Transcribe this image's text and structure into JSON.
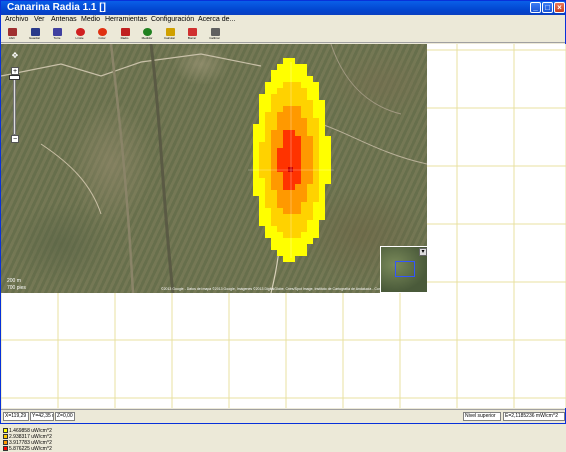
{
  "window": {
    "title": "Canarina Radia 1.1 []",
    "controls": {
      "minimize": "_",
      "maximize": "□",
      "close": "×"
    }
  },
  "menu": [
    "Archivo",
    "Ver",
    "Antenas",
    "Medio",
    "Herramientas",
    "Configuración",
    "Acerca de..."
  ],
  "toolbar": [
    {
      "label": "Abrir",
      "icon": "open-icon",
      "color": "#a03030"
    },
    {
      "label": "Guardar",
      "icon": "save-icon",
      "color": "#2a3a8a"
    },
    {
      "label": "Torre",
      "icon": "tower-icon",
      "color": "#4040a0"
    },
    {
      "label": "Limite",
      "icon": "limit-icon",
      "color": "#d02020"
    },
    {
      "label": "Color",
      "icon": "color-icon",
      "color": "#e03010"
    },
    {
      "label": "Radio",
      "icon": "radio-icon",
      "color": "#c02020"
    },
    {
      "label": "Medidor",
      "icon": "meter-icon",
      "color": "#208020"
    },
    {
      "label": "Calcular",
      "icon": "calculate-icon",
      "color": "#d0a000"
    },
    {
      "label": "Borrar",
      "icon": "erase-icon",
      "color": "#d03030"
    },
    {
      "label": "Calibrar",
      "icon": "calibrate-icon",
      "color": "#606060"
    }
  ],
  "map": {
    "scale_1": "200 m",
    "scale_2": "700 pies",
    "copyright": "©2013 Google - Datos del mapa ©2013 Google, Imágenes ©2013 DigitalGlobe, Cnes/Spot Image, Instituto de Cartografía de Andalucía - Condiciones del Servicio",
    "overview_button": "▾",
    "zoom_plus": "+",
    "zoom_minus": "−"
  },
  "heatmap": {
    "colors": [
      "#ffff00",
      "#ffd200",
      "#ff9900",
      "#ff3300"
    ],
    "center_color": "#cc0000"
  },
  "legend": [
    {
      "label": "1.469858 uW/cm^2",
      "color": "#ffff00"
    },
    {
      "label": "2.938317 uW/cm^2",
      "color": "#ffcc00"
    },
    {
      "label": "3.917783 uW/cm^2",
      "color": "#ff9900"
    },
    {
      "label": "5.876225 uW/cm^2",
      "color": "#ff0000"
    }
  ],
  "status": {
    "coord_x": "X=119,29 m",
    "coord_y": "Y=42,35 m",
    "coord_z": "Z=0,00 m",
    "mode": "Nivel superior",
    "value": "E=2,1185236 mW/cm^2"
  }
}
